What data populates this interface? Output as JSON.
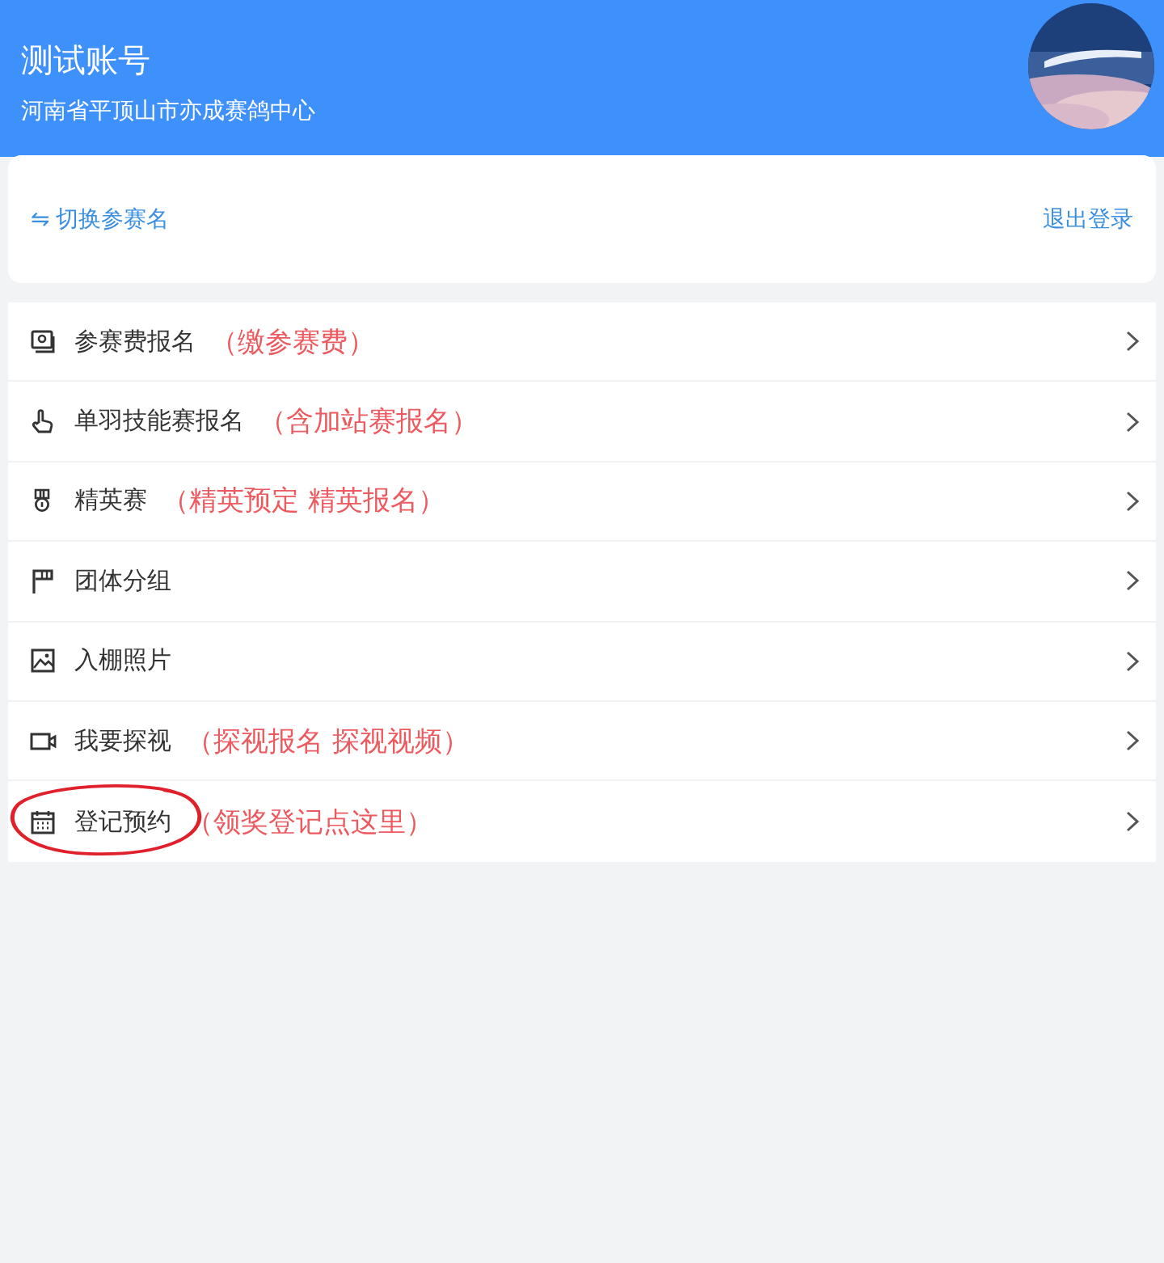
{
  "header": {
    "title": "测试账号",
    "subtitle": "河南省平顶山市亦成赛鸽中心"
  },
  "account_bar": {
    "switch_icon": "⇋",
    "switch_label": "切换参赛名",
    "logout": "退出登录"
  },
  "menu": [
    {
      "label": "参赛费报名",
      "note": "（缴参赛费）",
      "circled": false
    },
    {
      "label": "单羽技能赛报名",
      "note": "（含加站赛报名）",
      "circled": false
    },
    {
      "label": "精英赛",
      "note": "（精英预定 精英报名）",
      "circled": false
    },
    {
      "label": "团体分组",
      "circled": false
    },
    {
      "label": "入棚照片",
      "circled": false
    },
    {
      "label": "我要探视",
      "note": "（探视报名 探视视频）",
      "circled": false
    },
    {
      "label": "登记预约",
      "note": "（领奖登记点这里）",
      "circled": true
    }
  ]
}
